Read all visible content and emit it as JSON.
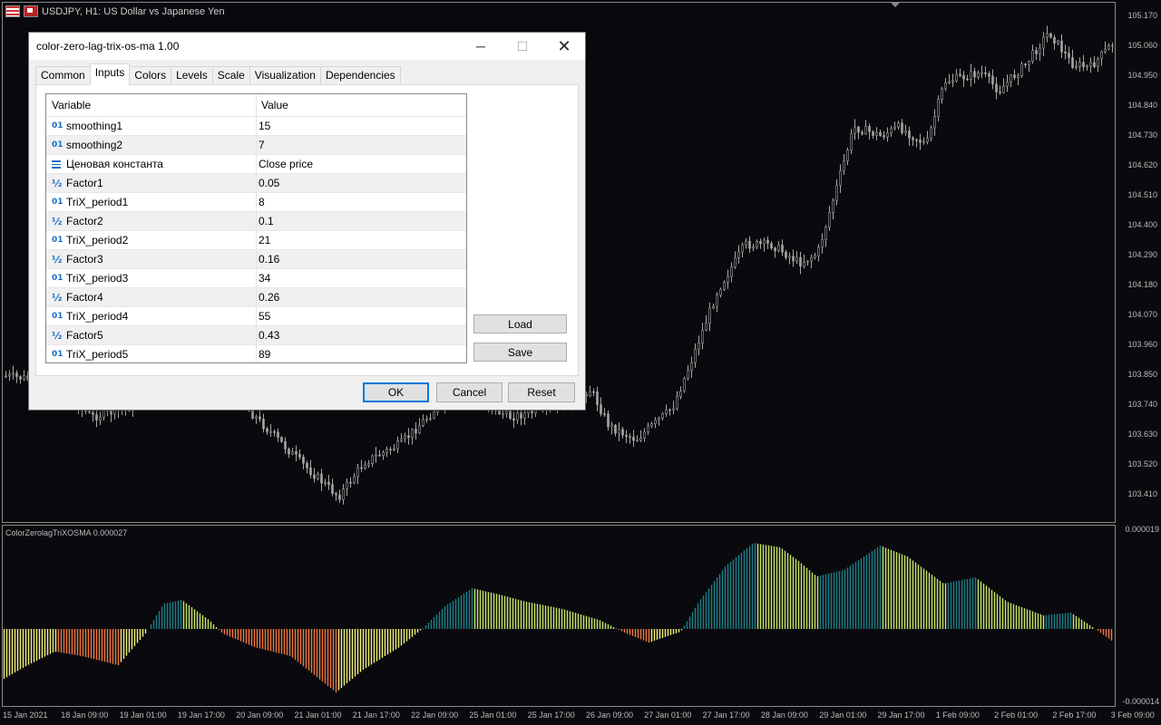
{
  "chart": {
    "symbol_title": "USDJPY, H1:  US Dollar vs Japanese Yen",
    "price_labels": [
      "105.170",
      "105.060",
      "104.950",
      "104.840",
      "104.730",
      "104.620",
      "104.510",
      "104.400",
      "104.290",
      "104.180",
      "104.070",
      "103.960",
      "103.850",
      "103.740",
      "103.630",
      "103.520",
      "103.410"
    ],
    "time_labels": [
      "15 Jan 2021",
      "18 Jan 09:00",
      "19 Jan 01:00",
      "19 Jan 17:00",
      "20 Jan 09:00",
      "21 Jan 01:00",
      "21 Jan 17:00",
      "22 Jan 09:00",
      "25 Jan 01:00",
      "25 Jan 17:00",
      "26 Jan 09:00",
      "27 Jan 01:00",
      "27 Jan 17:00",
      "28 Jan 09:00",
      "29 Jan 01:00",
      "29 Jan 17:00",
      "1 Feb 09:00",
      "2 Feb 01:00",
      "2 Feb 17:00",
      "3 Feb 09:00"
    ],
    "indicator_title": "ColorZerolagTriXOSMA 0.000027",
    "indicator_max": "0.000019",
    "indicator_min": "-0.000014",
    "colors": {
      "background": "#0a0a0e",
      "candle": "#a6a6a6",
      "bull_strong": "#1e7f8a",
      "bull_weak": "#c8e86a",
      "bear_strong": "#f07840",
      "bear_weak": "#f2f27a"
    }
  },
  "dialog": {
    "title": "color-zero-lag-trix-os-ma 1.00",
    "minimize_icon": "─",
    "maximize_icon": "☐",
    "close_icon": "✕",
    "tabs": [
      "Common",
      "Inputs",
      "Colors",
      "Levels",
      "Scale",
      "Visualization",
      "Dependencies"
    ],
    "active_tab": "Inputs",
    "columns": [
      "Variable",
      "Value"
    ],
    "rows": [
      {
        "icon": "01",
        "name": "smoothing1",
        "value": "15"
      },
      {
        "icon": "01",
        "name": "smoothing2",
        "value": "7"
      },
      {
        "icon": "enum",
        "name": "Ценовая константа",
        "value": "Close price"
      },
      {
        "icon": "½",
        "name": "Factor1",
        "value": "0.05"
      },
      {
        "icon": "01",
        "name": "TriX_period1",
        "value": "8"
      },
      {
        "icon": "½",
        "name": "Factor2",
        "value": "0.1"
      },
      {
        "icon": "01",
        "name": "TriX_period2",
        "value": "21"
      },
      {
        "icon": "½",
        "name": "Factor3",
        "value": "0.16"
      },
      {
        "icon": "01",
        "name": "TriX_period3",
        "value": "34"
      },
      {
        "icon": "½",
        "name": "Factor4",
        "value": "0.26"
      },
      {
        "icon": "01",
        "name": "TriX_period4",
        "value": "55"
      },
      {
        "icon": "½",
        "name": "Factor5",
        "value": "0.43"
      },
      {
        "icon": "01",
        "name": "TriX_period5",
        "value": "89"
      }
    ],
    "load_label": "Load",
    "save_label": "Save",
    "ok_label": "OK",
    "cancel_label": "Cancel",
    "reset_label": "Reset"
  }
}
